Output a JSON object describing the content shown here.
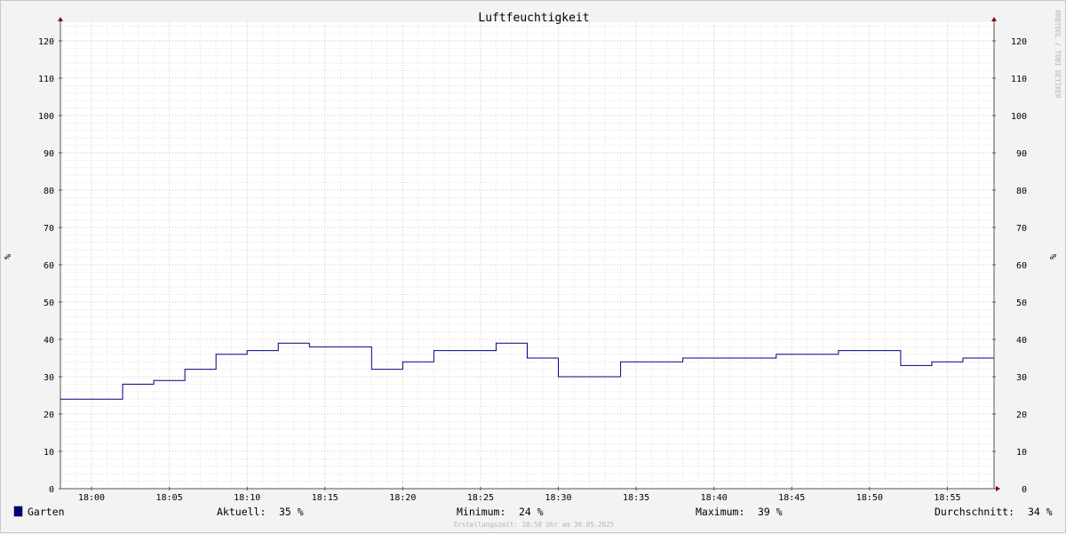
{
  "chart_data": {
    "type": "line",
    "title": "Luftfeuchtigkeit",
    "ylabel": "%",
    "ylabel_right": "%",
    "watermark": "RRDTOOL / TOBI OETIKER",
    "xlim": [
      "17:58",
      "18:58"
    ],
    "ylim": [
      0,
      125
    ],
    "yticks": [
      0,
      10,
      20,
      30,
      40,
      50,
      60,
      70,
      80,
      90,
      100,
      110,
      120
    ],
    "xticks": [
      "18:00",
      "18:05",
      "18:10",
      "18:15",
      "18:20",
      "18:25",
      "18:30",
      "18:35",
      "18:40",
      "18:45",
      "18:50",
      "18:55"
    ],
    "grid": true,
    "line_style": "step",
    "series": [
      {
        "name": "Garten",
        "color": "#000080",
        "x": [
          "17:58",
          "18:02",
          "18:04",
          "18:06",
          "18:08",
          "18:10",
          "18:12",
          "18:14",
          "18:18",
          "18:20",
          "18:22",
          "18:26",
          "18:28",
          "18:30",
          "18:34",
          "18:38",
          "18:44",
          "18:48",
          "18:52",
          "18:54",
          "18:56"
        ],
        "y": [
          24,
          28,
          29,
          32,
          36,
          37,
          39,
          38,
          32,
          34,
          37,
          39,
          35,
          30,
          34,
          35,
          36,
          37,
          33,
          34,
          35
        ]
      }
    ],
    "legend": {
      "series_label": "Garten",
      "current_label": "Aktuell:",
      "current_value": "35 %",
      "min_label": "Minimum:",
      "min_value": "24 %",
      "max_label": "Maximum:",
      "max_value": "39 %",
      "avg_label": "Durchschnitt:",
      "avg_value": "34 %"
    },
    "footer": "Erstellungszeit: 18:58 Uhr am 30.05.2025",
    "colors": {
      "background": "#f3f3f3",
      "canvas": "#ffffff",
      "major_grid": "#e6a0a0",
      "minor_grid": "#dedede",
      "axis": "#555555",
      "arrow": "#8b0000",
      "series": "#000080"
    }
  }
}
